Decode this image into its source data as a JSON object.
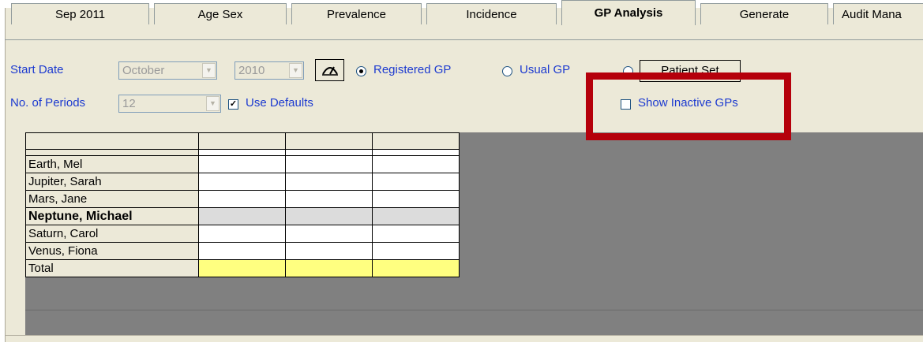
{
  "tabs": [
    {
      "label": "Sep 2011",
      "active": false
    },
    {
      "label": "Age Sex",
      "active": false
    },
    {
      "label": "Prevalence",
      "active": false
    },
    {
      "label": "Incidence",
      "active": false
    },
    {
      "label": "GP Analysis",
      "active": true
    },
    {
      "label": "Generate",
      "active": false
    },
    {
      "label": "Audit Mana",
      "active": false
    }
  ],
  "controls": {
    "start_date_label": "Start Date",
    "month_value": "October",
    "year_value": "2010",
    "registered_gp_label": "Registered GP",
    "usual_gp_label": "Usual GP",
    "patient_set_label": "Patient Set",
    "periods_label": "No. of Periods",
    "periods_value": "12",
    "use_defaults_label": "Use Defaults",
    "use_defaults_checked": true,
    "show_inactive_label": "Show Inactive GPs",
    "show_inactive_checked": false,
    "selected_radio": "Registered GP"
  },
  "grid": {
    "rows": [
      {
        "name": "Earth, Mel",
        "bold": false,
        "shade": "white"
      },
      {
        "name": "Jupiter, Sarah",
        "bold": false,
        "shade": "white"
      },
      {
        "name": "Mars, Jane",
        "bold": false,
        "shade": "white"
      },
      {
        "name": "Neptune, Michael",
        "bold": true,
        "shade": "grey"
      },
      {
        "name": "Saturn, Carol",
        "bold": false,
        "shade": "white"
      },
      {
        "name": "Venus, Fiona",
        "bold": false,
        "shade": "white"
      },
      {
        "name": "Total",
        "bold": false,
        "shade": "yellow"
      }
    ]
  },
  "colors": {
    "highlight_box": "#b5000b",
    "label_blue": "#1c3ad0",
    "grid_background": "#808080",
    "total_row": "#ffff80",
    "selected_row": "#dcdcdc",
    "header_cell": "#ece9d8"
  }
}
